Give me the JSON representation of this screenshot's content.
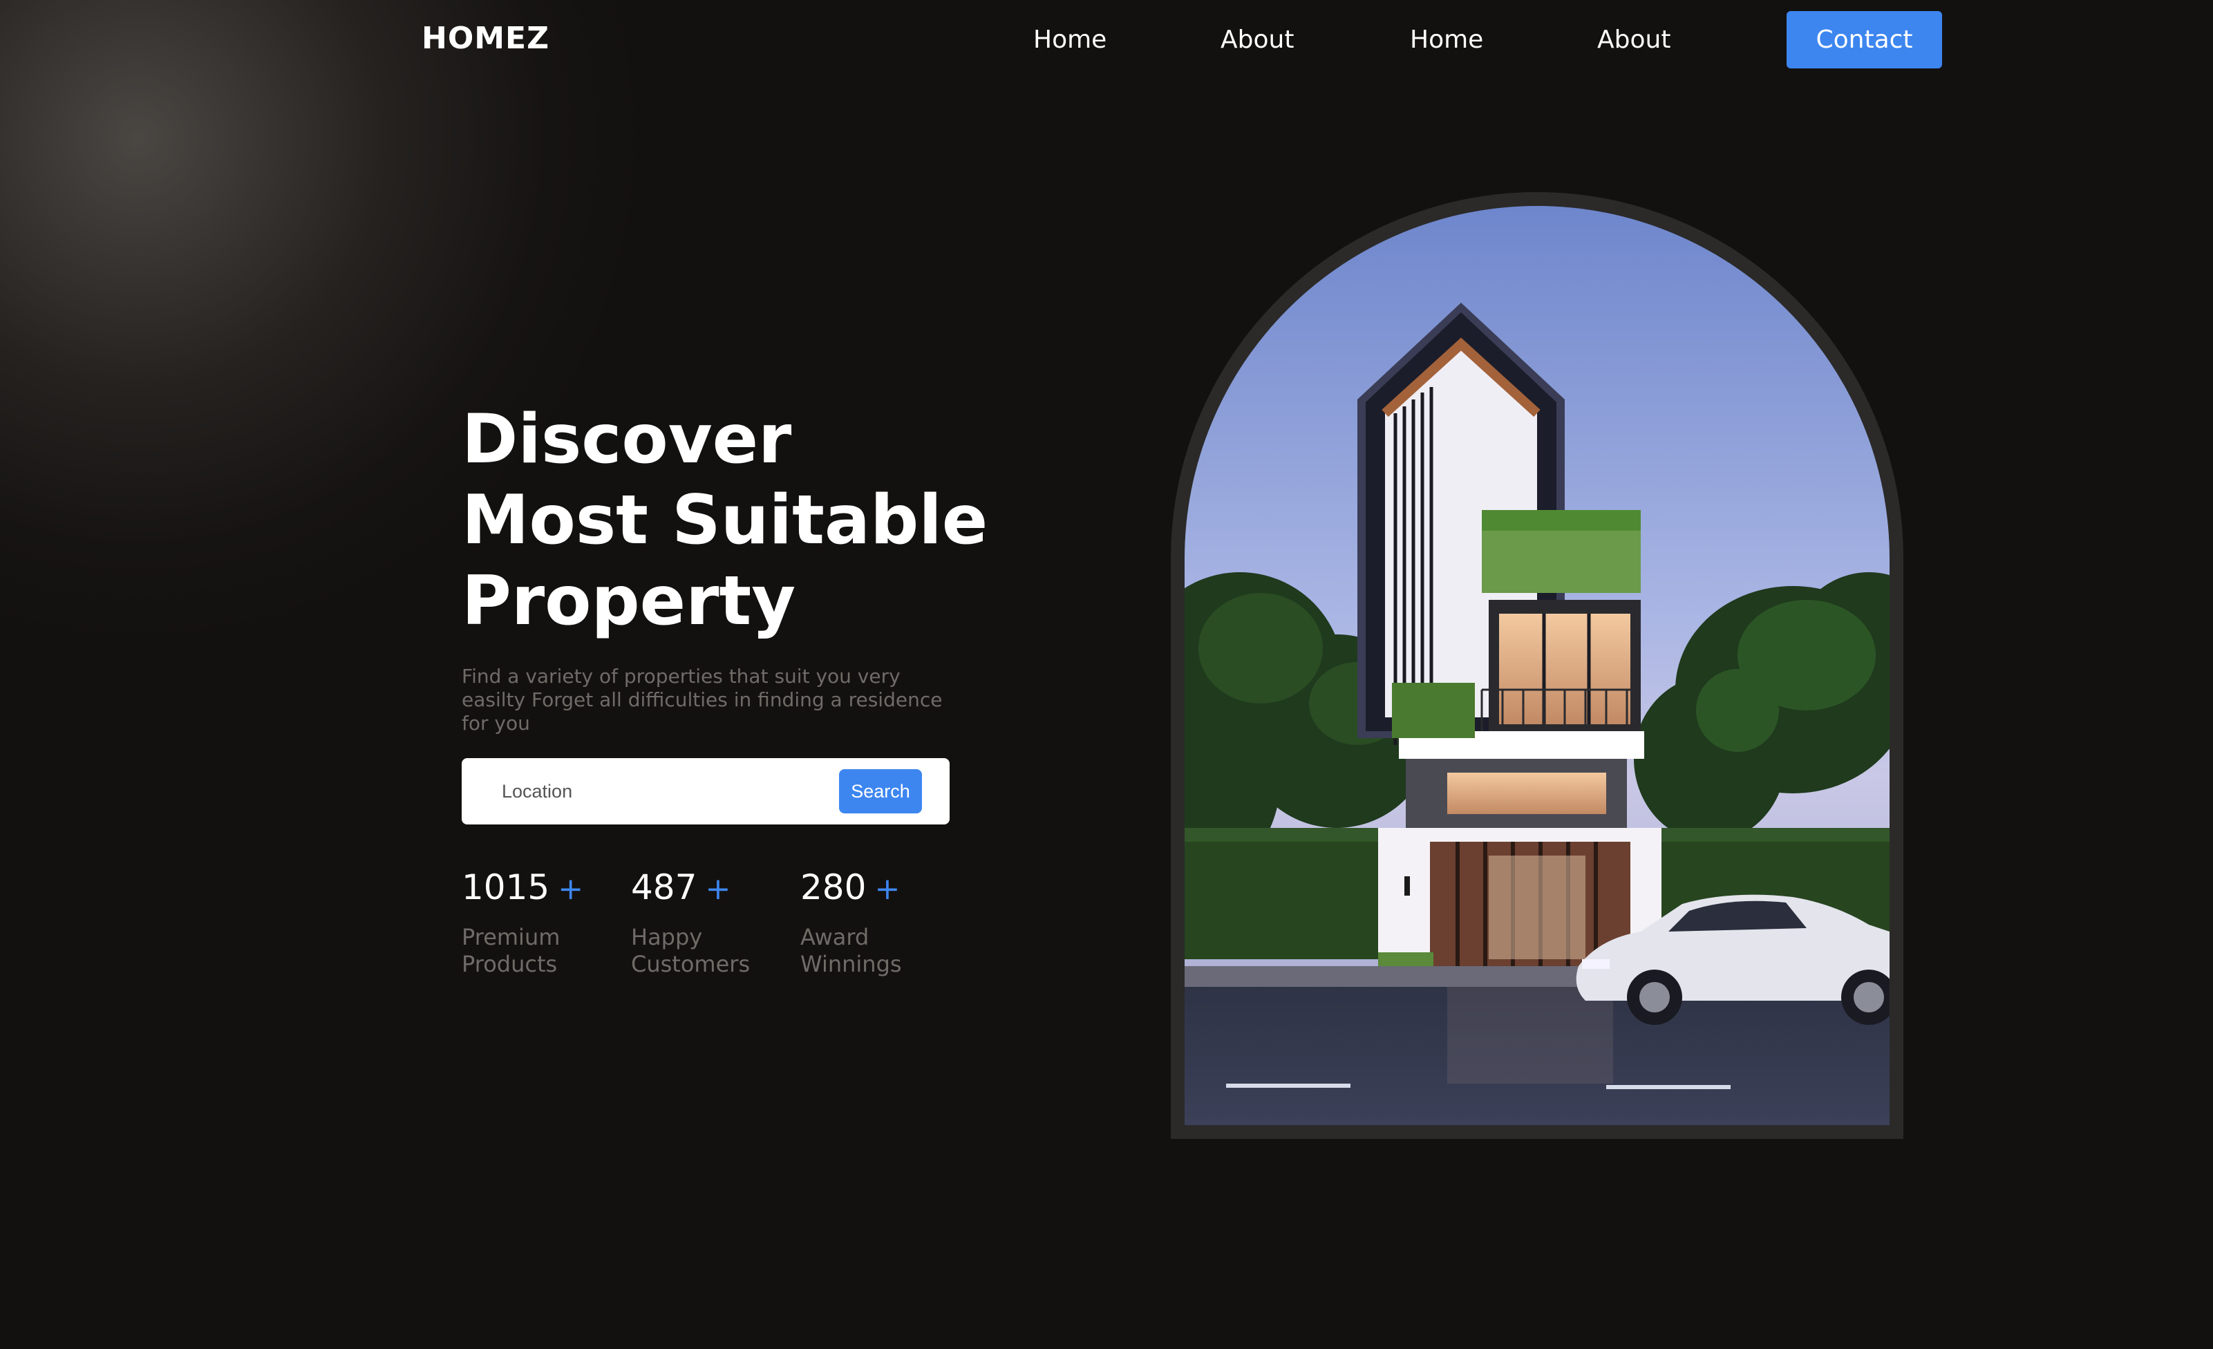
{
  "header": {
    "logo": "HOMEZ",
    "nav": [
      "Home",
      "About",
      "Home",
      "About"
    ],
    "contact_label": "Contact"
  },
  "hero": {
    "title_lines": [
      "Discover",
      "Most Suitable",
      "Property"
    ],
    "subtitle": "Find a variety of properties that suit you very easilty Forget all difficulties in finding a residence for you",
    "search": {
      "placeholder": "Location",
      "button_label": "Search"
    },
    "stats": [
      {
        "number": "1015",
        "plus": "+",
        "label": "Premium Products"
      },
      {
        "number": "487",
        "plus": "+",
        "label": "Happy Customers"
      },
      {
        "number": "280",
        "plus": "+",
        "label": "Award Winnings"
      }
    ]
  },
  "colors": {
    "background": "#131110",
    "accent": "#3d86f0",
    "muted_text": "#6f6b67"
  }
}
